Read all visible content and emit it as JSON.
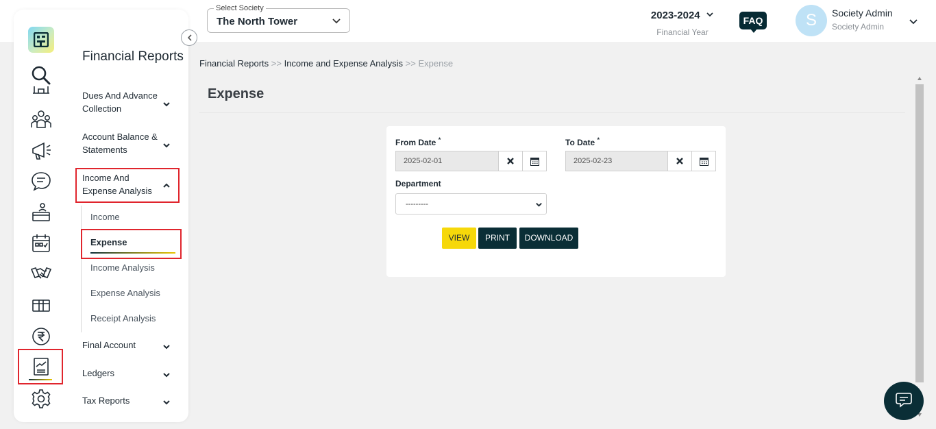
{
  "header": {
    "society_label": "Select Society",
    "society_value": "The North Tower",
    "financial_year": "2023-2024",
    "financial_year_label": "Financial Year",
    "faq_label": "FAQ",
    "avatar_initial": "S",
    "user_name": "Society Admin",
    "user_role": "Society Admin"
  },
  "sidebar": {
    "title": "Financial Reports",
    "nav_icons": [
      "search-icon",
      "building-icon",
      "members-icon",
      "announcement-icon",
      "chat-icon",
      "reception-icon",
      "calendar-icon",
      "handshake-icon",
      "parcel-icon",
      "rupee-icon",
      "reports-icon",
      "settings-icon"
    ],
    "menu": [
      {
        "label": "Dues And Advance Collection",
        "expanded": false
      },
      {
        "label": "Account Balance & Statements",
        "expanded": false
      },
      {
        "label": "Income And Expense Analysis",
        "expanded": true
      },
      {
        "label": "Final Account",
        "expanded": false
      },
      {
        "label": "Ledgers",
        "expanded": false
      },
      {
        "label": "Tax Reports",
        "expanded": false
      }
    ],
    "submenu": [
      {
        "label": "Income"
      },
      {
        "label": "Expense",
        "active": true
      },
      {
        "label": "Income Analysis"
      },
      {
        "label": "Expense Analysis"
      },
      {
        "label": "Receipt Analysis"
      }
    ]
  },
  "breadcrumb": {
    "items": [
      "Financial Reports",
      "Income and Expense Analysis",
      "Expense"
    ],
    "separator": ">>"
  },
  "page": {
    "title": "Expense"
  },
  "form": {
    "from_date_label": "From Date",
    "from_date_value": "2025-02-01",
    "to_date_label": "To Date",
    "to_date_value": "2025-02-23",
    "required_mark": "*",
    "department_label": "Department",
    "department_value": "---------",
    "view_label": "VIEW",
    "print_label": "PRINT",
    "download_label": "DOWNLOAD"
  },
  "colors": {
    "primary_dark": "#0a2e36",
    "accent_yellow": "#f6d80a",
    "highlight_red": "#e0252d"
  }
}
